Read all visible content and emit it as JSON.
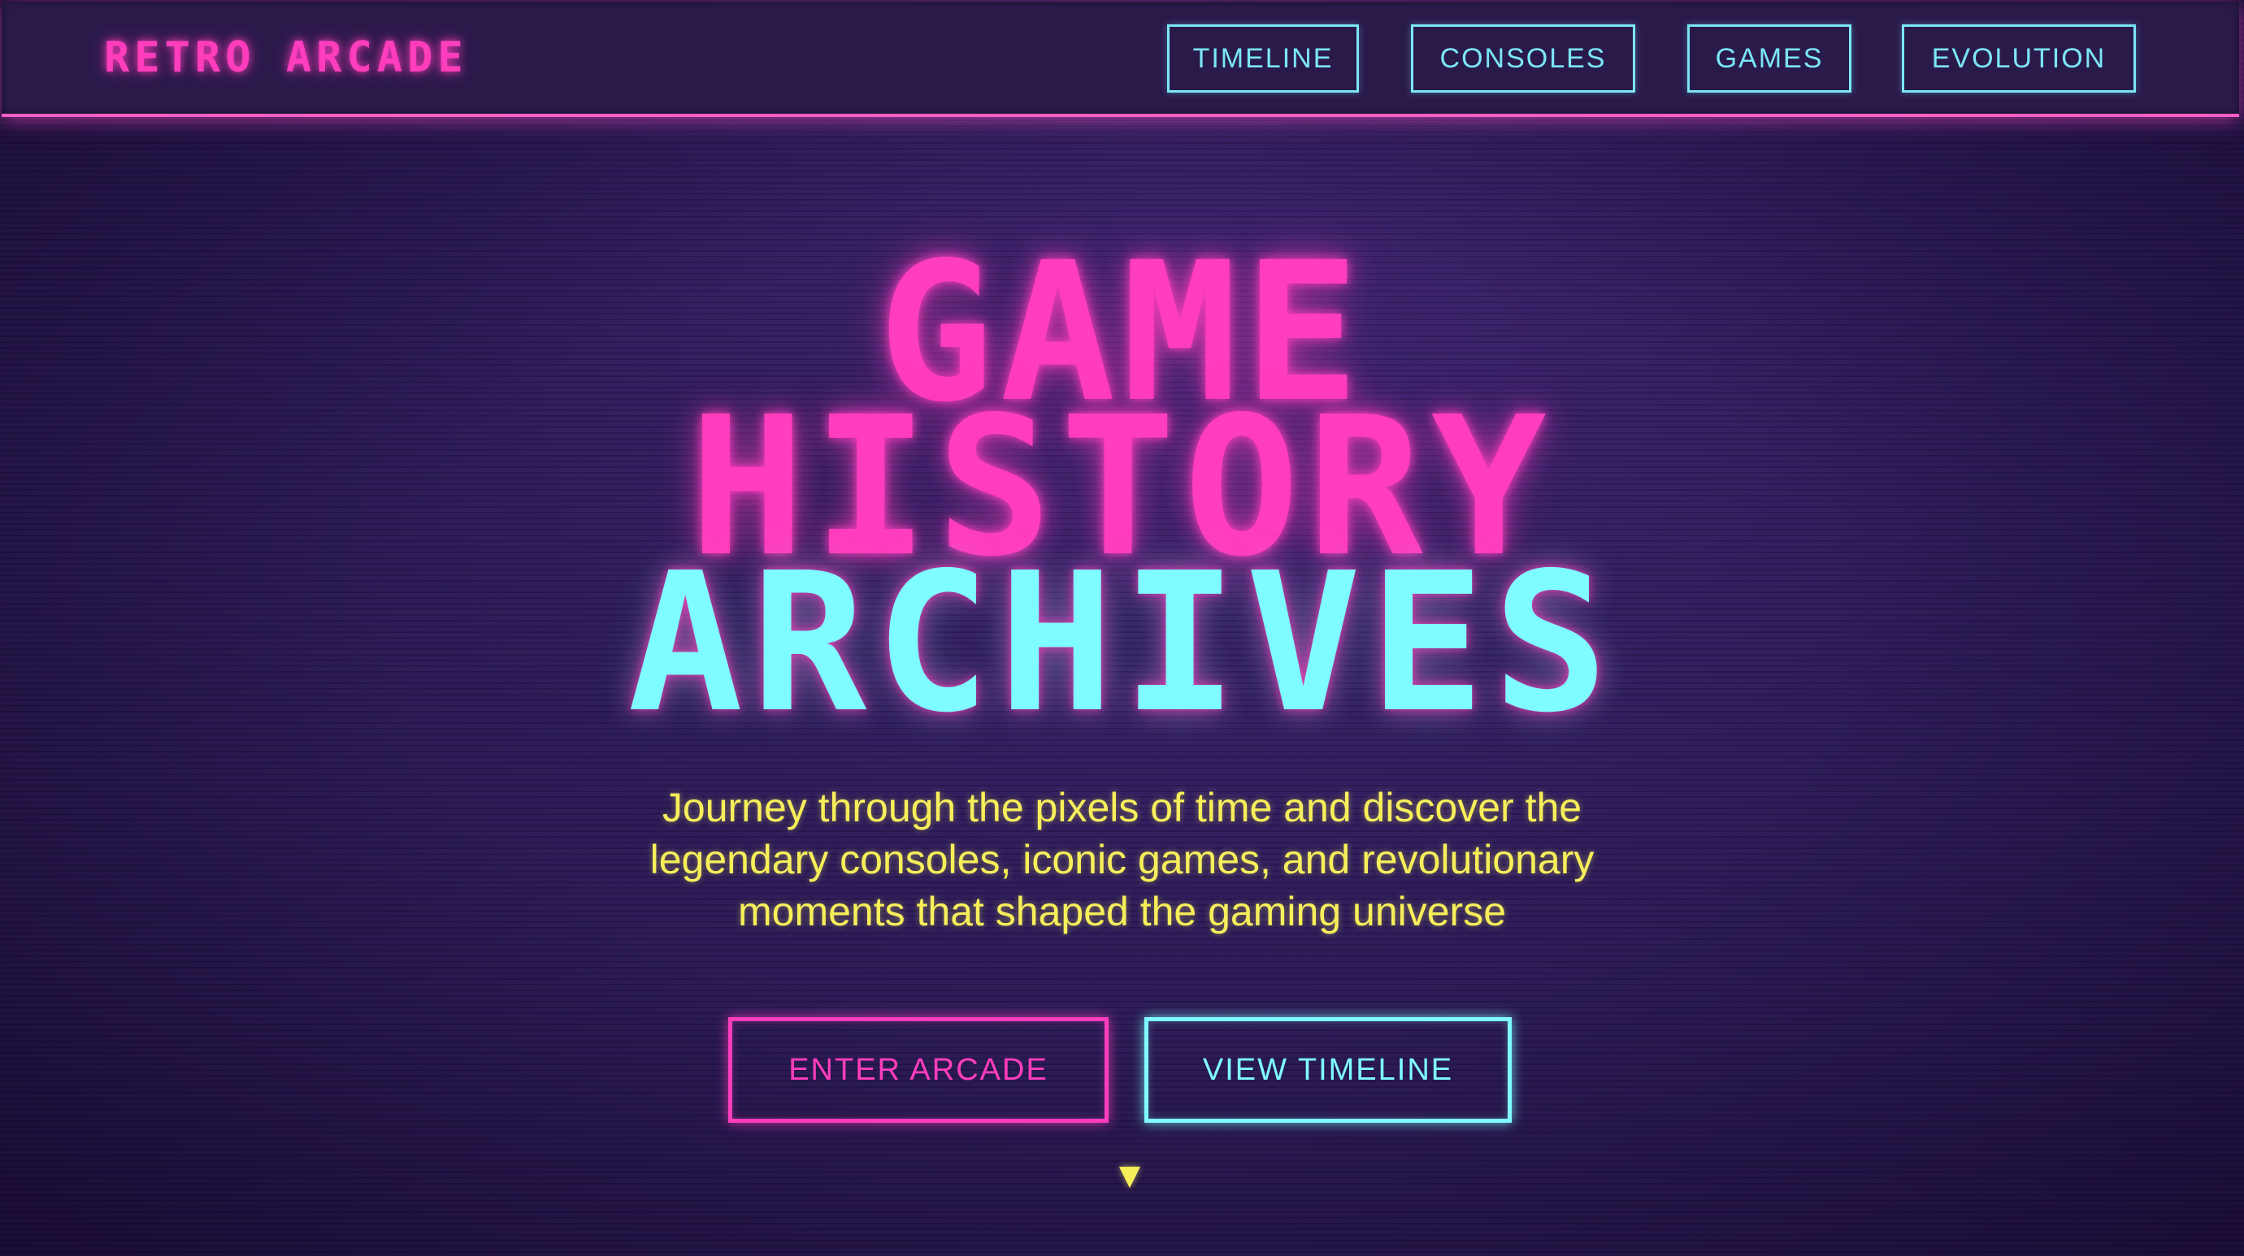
{
  "nav": {
    "logo": "RETRO ARCADE",
    "links": [
      {
        "label": "TIMELINE"
      },
      {
        "label": "CONSOLES"
      },
      {
        "label": "GAMES"
      },
      {
        "label": "EVOLUTION"
      }
    ]
  },
  "hero": {
    "title_line1": "GAME",
    "title_line2": "HISTORY",
    "title_line3": "ARCHIVES",
    "subtitle_line1": "Journey through the pixels of time and discover the",
    "subtitle_line2": "legendary consoles, iconic games, and revolutionary",
    "subtitle_line3": "moments that shaped the gaming universe",
    "primary_button": "ENTER ARCADE",
    "secondary_button": "VIEW TIMELINE",
    "scroll_indicator": "▼"
  },
  "colors": {
    "background": "#2c1a58",
    "neon_pink": "#ff3dbd",
    "neon_cyan": "#7ffcff",
    "accent_yellow": "#f7ef5a"
  },
  "icons": {
    "scroll": "chevron-down-icon"
  }
}
